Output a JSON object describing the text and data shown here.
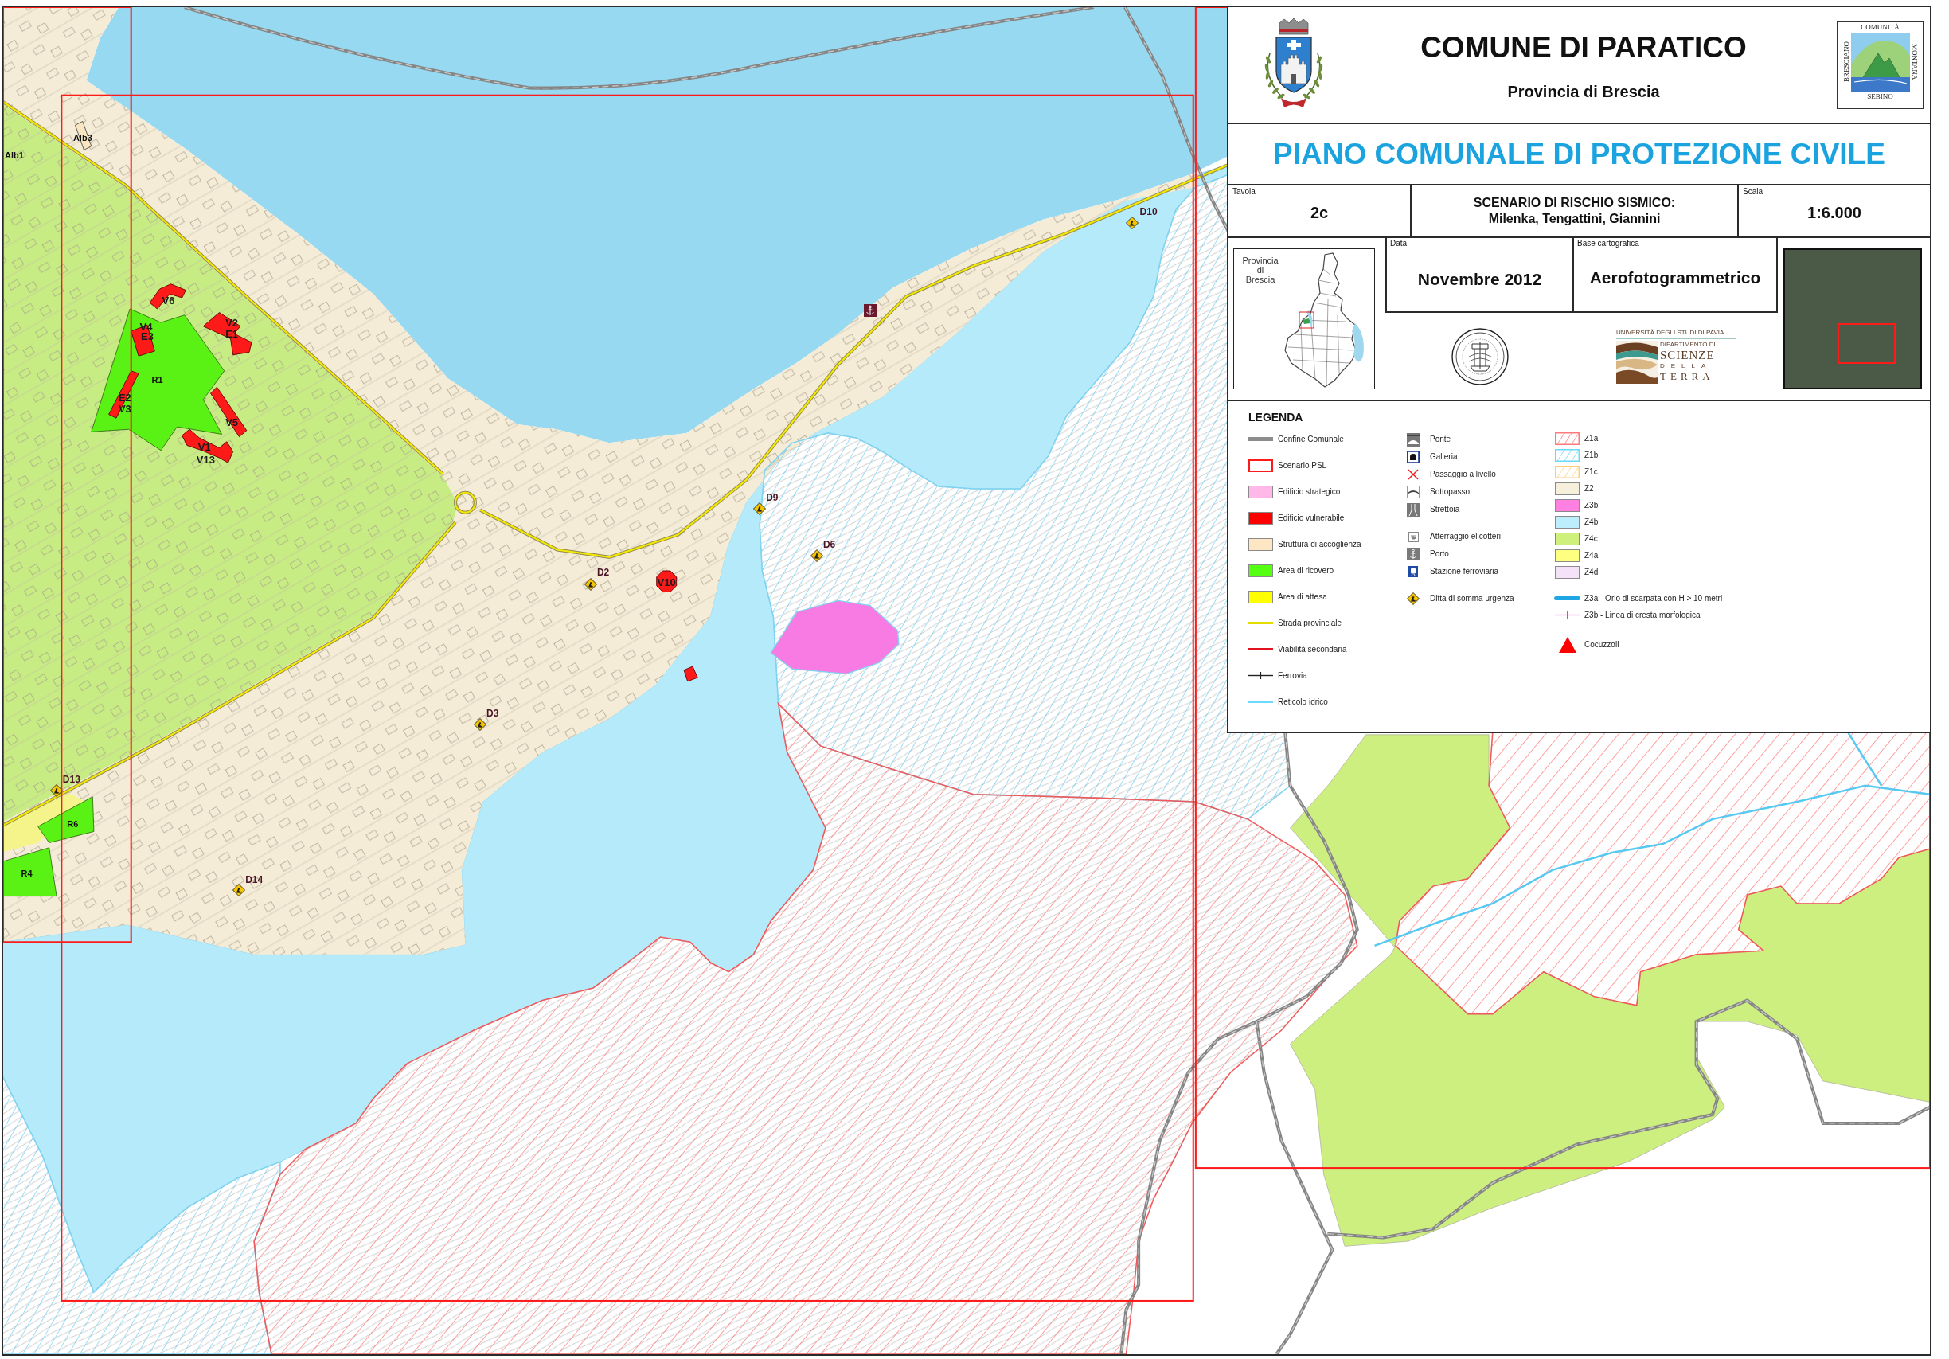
{
  "title_block": {
    "municipality": "COMUNE DI PARATICO",
    "province": "Provincia di Brescia",
    "community_logo": {
      "top": "COMUNITÀ",
      "left": "BRESCIANO",
      "right": "MONTANA",
      "bottom": "SEBINO"
    },
    "plan_title": "PIANO COMUNALE DI PROTEZIONE CIVILE",
    "sheet": {
      "label": "Tavola",
      "value": "2c"
    },
    "scenario": {
      "title": "SCENARIO DI RISCHIO SISMICO:",
      "authors": "Milenka, Tengattini, Giannini"
    },
    "scale": {
      "label": "Scala",
      "value": "1:6.000"
    },
    "locator_map": {
      "caption": "Provincia di Brescia"
    },
    "date": {
      "label": "Data",
      "value": "Novembre 2012"
    },
    "base_map": {
      "label": "Base cartografica",
      "value": "Aerofotogrammetrico"
    },
    "department_logo": {
      "university": "UNIVERSITÀ DEGLI STUDI DI PAVIA",
      "department": "DIPARTIMENTO DI",
      "name": "SCIENZE",
      "line_3": "DELLA",
      "line_4": "TERRA"
    }
  },
  "legend": {
    "title": "LEGENDA",
    "columns": [
      {
        "groups": [
          {
            "items": [
              {
                "label": "Confine Comunale",
                "kind": "dashed",
                "color": "#8c8c8c"
              },
              {
                "label": "Scenario PSL",
                "kind": "outline",
                "color": "#ff1a1a"
              },
              {
                "label": "Edificio strategico",
                "kind": "fill",
                "color": "#ffb8e8"
              },
              {
                "label": "Edificio vulnerabile",
                "kind": "fill",
                "color": "#ff0000"
              },
              {
                "label": "Struttura di accoglienza",
                "kind": "fill",
                "color": "#fde6c4"
              },
              {
                "label": "Area di ricovero",
                "kind": "fill",
                "color": "#55ff11"
              },
              {
                "label": "Area di attesa",
                "kind": "fill",
                "color": "#ffff00"
              },
              {
                "label": "Strada provinciale",
                "kind": "line",
                "color": "#e5dc00"
              },
              {
                "label": "Viabilità secondaria",
                "kind": "line",
                "color": "#e0141e"
              },
              {
                "label": "Ferrovia",
                "kind": "rail",
                "color": "#222222"
              },
              {
                "label": "Reticolo idrico",
                "kind": "line",
                "color": "#6fd8ff"
              }
            ]
          }
        ]
      },
      {
        "groups": [
          {
            "items": [
              {
                "label": "Ponte",
                "kind": "bridge"
              },
              {
                "label": "Galleria",
                "kind": "tunnel"
              },
              {
                "label": "Passaggio a livello",
                "kind": "cross"
              },
              {
                "label": "Sottopasso",
                "kind": "underpass"
              },
              {
                "label": "Strettoia",
                "kind": "narrowing"
              }
            ]
          },
          {
            "items": [
              {
                "label": "Atterraggio elicotteri",
                "kind": "helipad"
              },
              {
                "label": "Porto",
                "kind": "anchor"
              },
              {
                "label": "Stazione ferroviaria",
                "kind": "train"
              }
            ]
          },
          {
            "items": [
              {
                "label": "Ditta di somma urgenza",
                "kind": "diamond"
              }
            ]
          }
        ]
      },
      {
        "groups": [
          {
            "items": [
              {
                "label": "Z1a",
                "kind": "hatch",
                "color": "#ff7a7a"
              },
              {
                "label": "Z1b",
                "kind": "hatch",
                "color": "#6ad8f7"
              },
              {
                "label": "Z1c",
                "kind": "hatch",
                "color": "#ffcc77"
              },
              {
                "label": "Z2",
                "kind": "fill",
                "color": "#f5efdc"
              },
              {
                "label": "Z3b",
                "kind": "fill",
                "color": "#ff80e0"
              },
              {
                "label": "Z4b",
                "kind": "fill",
                "color": "#bdeefb"
              },
              {
                "label": "Z4c",
                "kind": "fill",
                "color": "#cff07c"
              },
              {
                "label": "Z4a",
                "kind": "fill",
                "color": "#ffff80"
              },
              {
                "label": "Z4d",
                "kind": "fill",
                "color": "#f3e2f8"
              }
            ]
          },
          {
            "items": [
              {
                "label": "Z3a - Orlo di scarpata con H > 10 metri",
                "kind": "thick",
                "color": "#1ea6e2"
              },
              {
                "label": "Z3b - Linea di cresta morfologica",
                "kind": "tick",
                "color": "#e83cc8"
              }
            ]
          },
          {
            "items": [
              {
                "label": "Cocuzzoli",
                "kind": "triangle",
                "color": "#ff0000"
              }
            ]
          }
        ]
      }
    ]
  },
  "map": {
    "labels": [
      {
        "text": "Alb3",
        "kind": "area"
      },
      {
        "text": "Alb1",
        "kind": "area"
      },
      {
        "text": "V6",
        "kind": "building"
      },
      {
        "text": "V2",
        "kind": "building"
      },
      {
        "text": "V4",
        "kind": "building"
      },
      {
        "text": "E1",
        "kind": "building"
      },
      {
        "text": "E3",
        "kind": "building"
      },
      {
        "text": "R1",
        "kind": "area"
      },
      {
        "text": "E2",
        "kind": "building"
      },
      {
        "text": "V3",
        "kind": "building"
      },
      {
        "text": "V5",
        "kind": "building"
      },
      {
        "text": "V1",
        "kind": "building"
      },
      {
        "text": "V13",
        "kind": "building"
      },
      {
        "text": "V10",
        "kind": "building"
      },
      {
        "text": "R6",
        "kind": "area"
      },
      {
        "text": "R4",
        "kind": "area"
      }
    ],
    "company_markers": [
      {
        "label": "D10"
      },
      {
        "label": "D9"
      },
      {
        "label": "D6"
      },
      {
        "label": "D2"
      },
      {
        "label": "D3"
      },
      {
        "label": "D13"
      },
      {
        "label": "D14"
      }
    ]
  }
}
